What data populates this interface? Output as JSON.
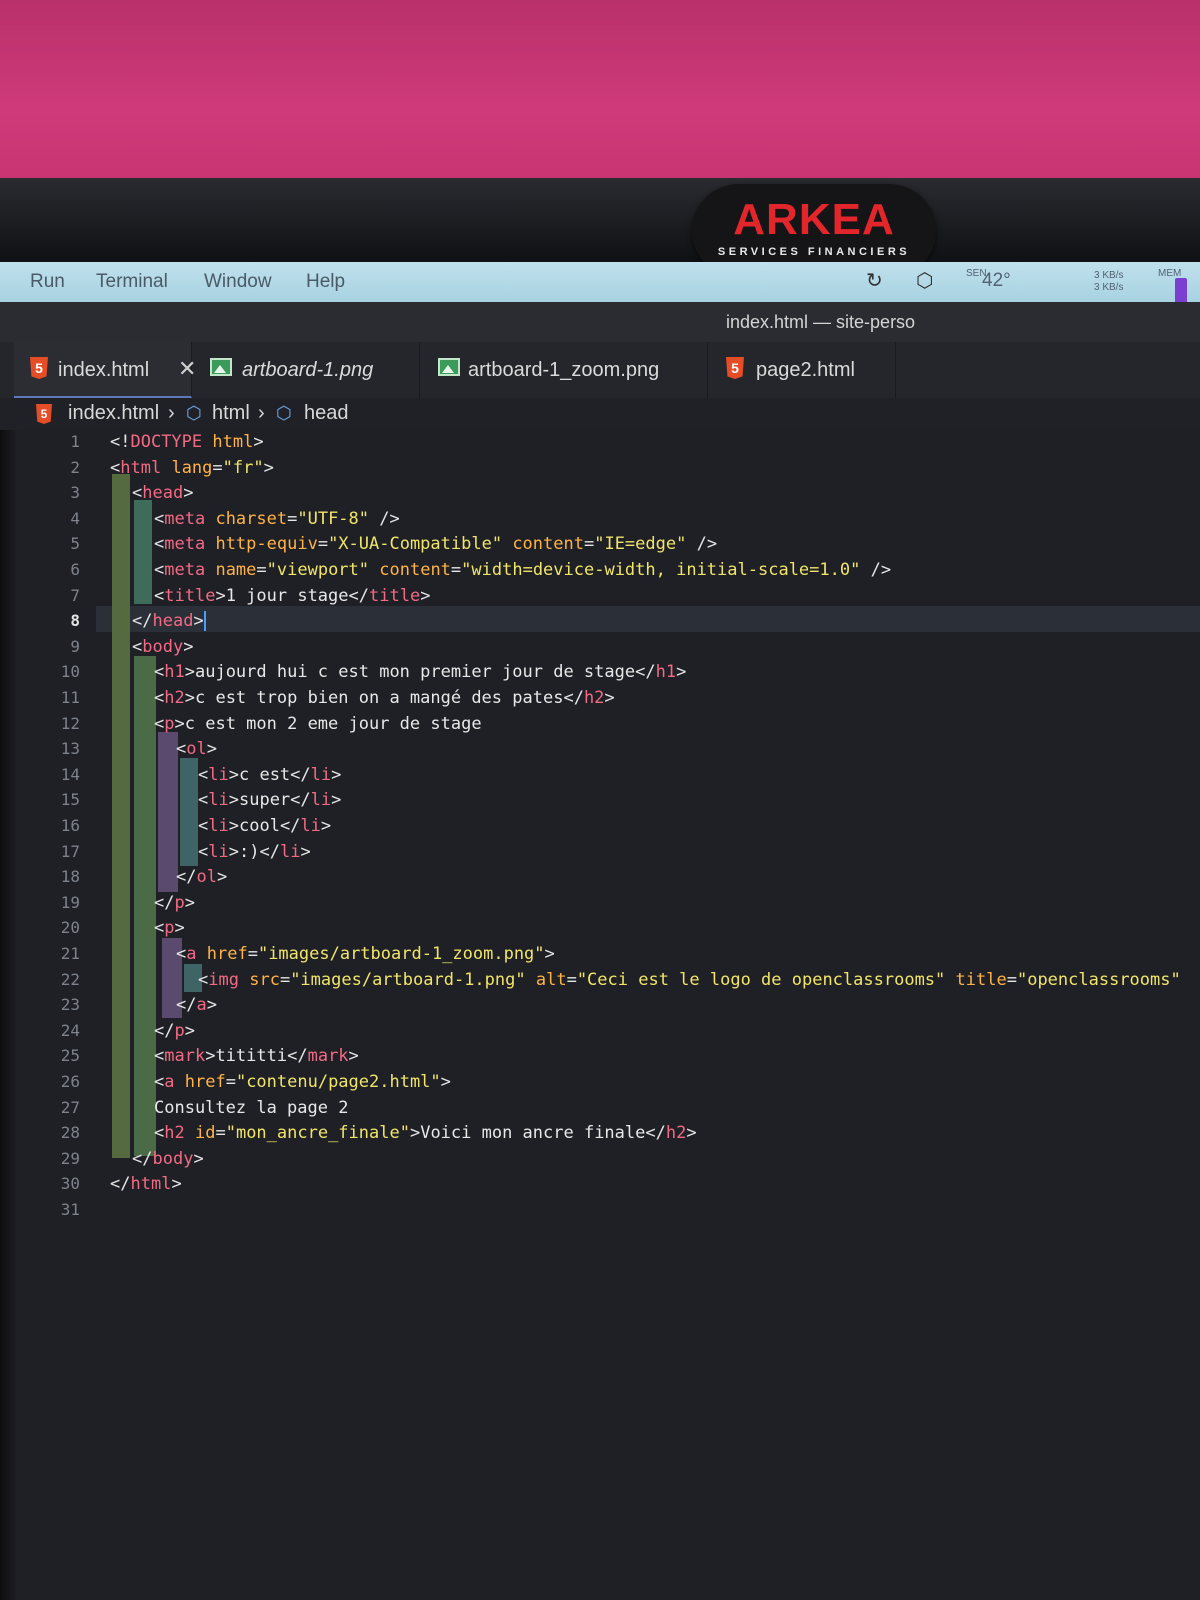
{
  "webcam_cover": {
    "logo": "ARKEA",
    "tagline": "SERVICES FINANCIERS"
  },
  "menubar": {
    "items": [
      "Run",
      "Terminal",
      "Window",
      "Help"
    ],
    "temp_label": "SEN",
    "temperature": "42°",
    "net_up": "3 KB/s",
    "net_down": "3 KB/s",
    "mem_label": "MEM",
    "icons": [
      "sync-icon",
      "cube-icon"
    ]
  },
  "window": {
    "title": "index.html — site-perso"
  },
  "tabs": [
    {
      "label": "index.html",
      "icon": "html5-icon",
      "active": true,
      "closable": true
    },
    {
      "label": "artboard-1.png",
      "icon": "image-icon",
      "active": false
    },
    {
      "label": "artboard-1_zoom.png",
      "icon": "image-icon",
      "active": false
    },
    {
      "label": "page2.html",
      "icon": "html5-icon",
      "active": false
    }
  ],
  "breadcrumb": [
    "index.html",
    "html",
    "head"
  ],
  "editor": {
    "current_line": 8,
    "line_count": 31,
    "lines": [
      "<!DOCTYPE html>",
      "<html lang=\"fr\">",
      "<head>",
      "<meta charset=\"UTF-8\" />",
      "<meta http-equiv=\"X-UA-Compatible\" content=\"IE=edge\" />",
      "<meta name=\"viewport\" content=\"width=device-width, initial-scale=1.0\" />",
      "<title>1 jour stage</title>",
      "</head>",
      "<body>",
      "<h1>aujourd hui c est mon premier jour de stage</h1>",
      "<h2>c est trop bien on a mangé des pates</h2>",
      "<p>c est mon 2 eme jour de stage",
      "<ol>",
      "<li>c est</li>",
      "<li>super</li>",
      "<li>cool</li>",
      "<li>:)</li>",
      "</ol>",
      "</p>",
      "<p>",
      "<a href=\"images/artboard-1_zoom.png\">",
      "<img src=\"images/artboard-1.png\" alt=\"Ceci est le logo de openclassrooms\" title=\"openclassrooms\"",
      "</a>",
      "</p>",
      "<mark>tititti</mark>",
      "<a href=\"contenu/page2.html\">",
      "Consultez la page 2",
      "<h2 id=\"mon_ancre_finale\">Voici mon ancre finale</h2>",
      "</body>",
      "</html>",
      ""
    ]
  }
}
